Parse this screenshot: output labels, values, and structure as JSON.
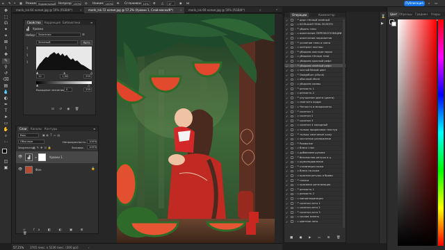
{
  "options_bar": {
    "mode_label": "Режим:",
    "mode_value": "Нормальный",
    "opacity_label": "Непрозр.:",
    "opacity_value": "100%",
    "pressure_label": "Нажим:",
    "pressure_value": "100%",
    "smoothing_label": "Сглаживание:",
    "smoothing_value": "10%",
    "angle_value": "0°",
    "share_button": "Публикация"
  },
  "tabs": [
    {
      "label": "marik_lsk-64 копия.jpg @ 50% (RGB/8*)",
      "close": "×"
    },
    {
      "label": "marik_lsk-72 копия.jpg @ 57,2% (Уровни 1, Слой-маска/8*)",
      "close": "×"
    },
    {
      "label": "marik_lsk-69 копия.jpg @ 50% (RGB/8*)",
      "close": "×"
    }
  ],
  "properties_panel": {
    "tabs": [
      "Свойства",
      "Коррекция",
      "Библиотеки"
    ],
    "subtitle": "Уровни",
    "preset_label": "Набор:",
    "preset_value": "Заказная",
    "channel_value": "Зеленый",
    "auto_button": "Авто",
    "input_black": "12",
    "input_gamma": "1,00",
    "input_white": "255",
    "output_label": "Выходные значения:",
    "output_black": "0",
    "output_white": "255"
  },
  "layers_panel": {
    "tabs": [
      "Слои",
      "Каналы",
      "Контуры"
    ],
    "filter_label": "Вид",
    "blend_mode": "Обычные",
    "opacity_label": "Непрозрачность:",
    "opacity_value": "100%",
    "lock_label": "Закрепить:",
    "fill_label": "Заливка:",
    "fill_value": "100%",
    "layers": [
      {
        "name": "Уровни 1",
        "selected": true
      },
      {
        "name": "Фон",
        "selected": false
      }
    ]
  },
  "actions_panel": {
    "tabs": [
      "Операции",
      "Комментар"
    ],
    "items": [
      {
        "label": "дерн тёплый зелёный",
        "selected": false
      },
      {
        "label": "БОЛЬШАЯ ТЕНЬ ЗОЛОТО",
        "selected": false
      },
      {
        "label": "убрать тени",
        "selected": false
      },
      {
        "label": "осветление ПЕРЕЭКСПОЗИЦИИ",
        "selected": false
      },
      {
        "label": "осветление пересветов",
        "selected": false
      },
      {
        "label": "усиление тени и света",
        "selected": false
      },
      {
        "label": "контраст хистиш",
        "selected": false
      },
      {
        "label": "убираем жесткие перех",
        "selected": false
      },
      {
        "label": "убираем тёплые тени",
        "selected": false
      },
      {
        "label": "убираем красный рефл",
        "selected": false
      },
      {
        "label": "убираем зелёный рефл",
        "selected": true
      },
      {
        "label": "чистый белый цвет",
        "selected": false
      },
      {
        "label": "DodgeBurn (dfunk)",
        "selected": false
      },
      {
        "label": "обычный dfunk",
        "selected": false
      },
      {
        "label": "убираем холмы",
        "selected": false
      },
      {
        "label": "резкость 1",
        "selected": false
      },
      {
        "label": "резкость 2",
        "selected": false
      },
      {
        "label": "улучшение цвета (цвета)",
        "selected": false
      },
      {
        "label": "смягчить кадра",
        "selected": false
      },
      {
        "label": "Четкость и микроконтр",
        "selected": false
      },
      {
        "label": "скинтон 1",
        "selected": false
      },
      {
        "label": "скинтон 2",
        "selected": false
      },
      {
        "label": "скинтон 3",
        "selected": false
      },
      {
        "label": "скинтон 4 холодный",
        "selected": false
      },
      {
        "label": "только прорисовки текстур",
        "selected": false
      },
      {
        "label": "только смягчение кожу",
        "selected": false
      },
      {
        "label": "частотное разложение",
        "selected": false
      },
      {
        "label": "Размытие",
        "selected": false
      },
      {
        "label": "блеск глаз",
        "selected": false
      },
      {
        "label": "добавляем румяна",
        "selected": false
      },
      {
        "label": "безопасная ретушь в ц",
        "selected": false
      },
      {
        "label": "шумоподавление",
        "selected": false
      },
      {
        "label": "стилизация кожи",
        "selected": false
      },
      {
        "label": "блеск на коже",
        "selected": false
      },
      {
        "label": "красная ретушь и брови",
        "selected": false
      },
      {
        "label": "глазки",
        "selected": false
      },
      {
        "label": "красивая детализация",
        "selected": false
      },
      {
        "label": "резкость 1",
        "selected": false
      },
      {
        "label": "резкость 2",
        "selected": false
      },
      {
        "label": "миниатюризация",
        "selected": false
      },
      {
        "label": "скинтон лето 1",
        "selected": false
      },
      {
        "label": "скинтон лето 2",
        "selected": false
      },
      {
        "label": "скинтон лето 3",
        "selected": false
      },
      {
        "label": "сочная зелень",
        "selected": false
      },
      {
        "label": "цветное лето",
        "selected": false
      }
    ]
  },
  "color_panel": {
    "tabs": [
      "Цвет",
      "Образцы",
      "Градиен",
      "Узоры"
    ],
    "foreground": "#000000",
    "background": "#ffffff",
    "hue_color": "#ff0000"
  },
  "status": {
    "zoom": "57,21%",
    "doc_size": "3765 пикс. x 5236 пикс. (300 ppi)"
  }
}
